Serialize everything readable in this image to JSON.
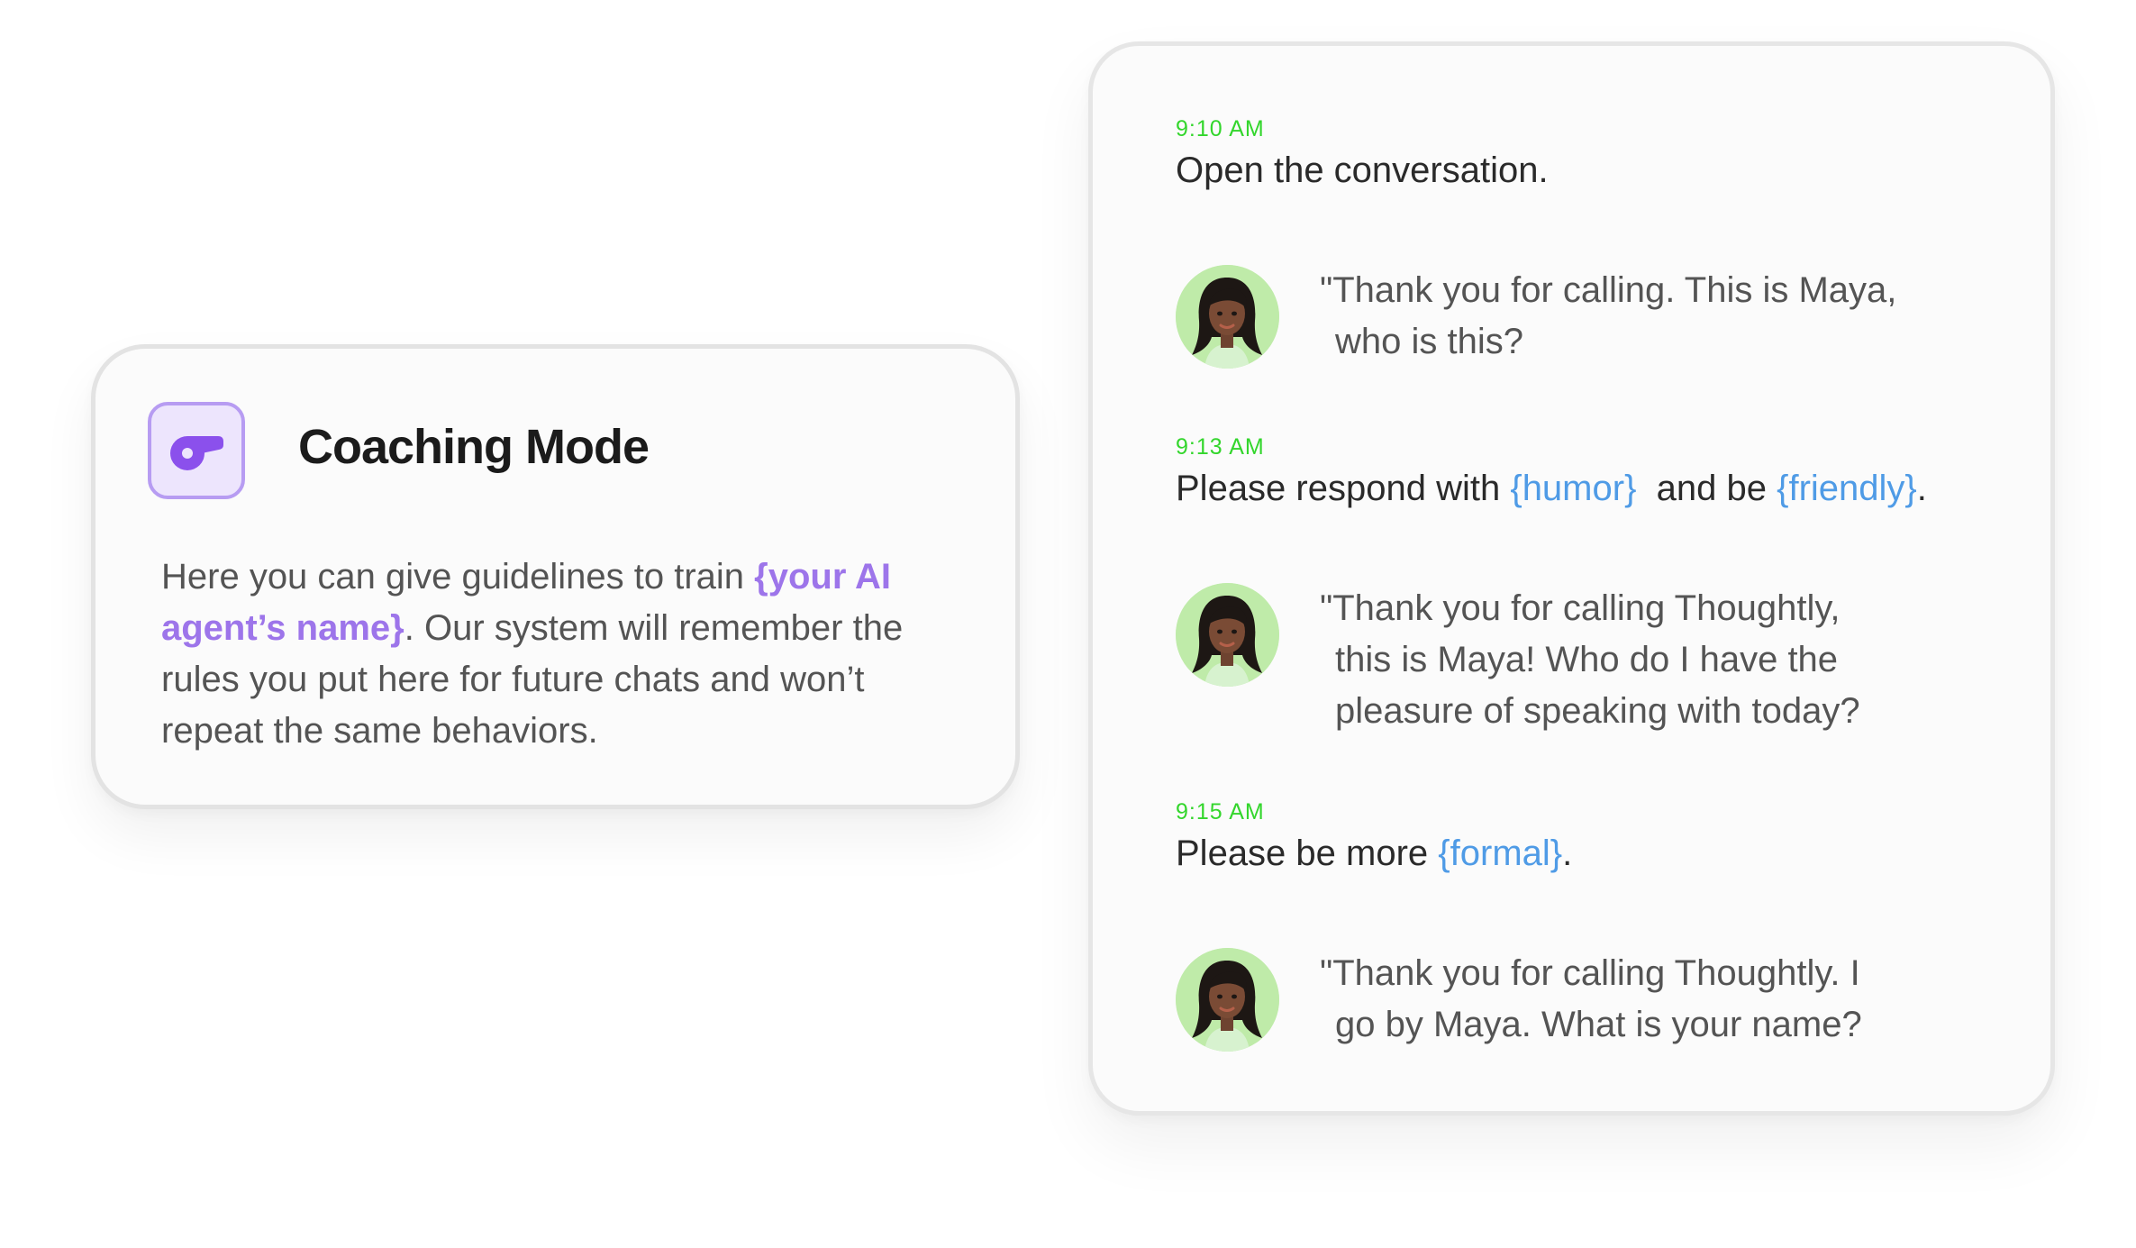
{
  "coaching": {
    "icon": "whistle-icon",
    "title": "Coaching Mode",
    "desc_before": "Here you can give guidelines to train ",
    "desc_highlight": "{your AI agent’s name}",
    "desc_after": ". Our system will remember the rules you put here for future chats and won’t repeat the same behaviors.",
    "accent_color": "#9d75ea"
  },
  "conversation": {
    "blocks": [
      {
        "time": "9:10 AM",
        "instruction": {
          "parts": [
            "Open the conversation.",
            "",
            "",
            "",
            ""
          ]
        },
        "reply_lines": [
          "\"Thank you for calling. This is Maya,",
          "who is this?"
        ]
      },
      {
        "time": "9:13 AM",
        "instruction": {
          "parts": [
            "Please respond with ",
            "{humor}",
            "  and be ",
            "{friendly}",
            "."
          ]
        },
        "reply_lines": [
          "\"Thank you for calling Thoughtly,",
          "this is Maya! Who do I have the",
          "pleasure of speaking with today?"
        ]
      },
      {
        "time": "9:15 AM",
        "instruction": {
          "parts": [
            "Please be more ",
            "{formal}",
            ".",
            "",
            ""
          ]
        },
        "reply_lines": [
          "\"Thank you for calling Thoughtly. I",
          "go by Maya. What is your name?"
        ]
      }
    ],
    "avatar_icon": "agent-avatar-icon",
    "timestamp_color": "#33d62c",
    "variable_color": "#4f9be6"
  }
}
